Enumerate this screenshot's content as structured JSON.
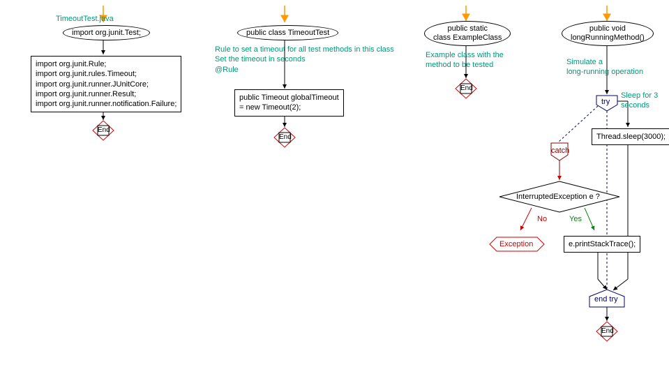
{
  "chart_data": {
    "type": "flowchart",
    "branches": [
      {
        "title": "TimeoutTest.java",
        "nodes": [
          {
            "type": "ellipse",
            "text": "import org.junit.Test;"
          },
          {
            "type": "rect",
            "text": "import org.junit.Rule;\nimport org.junit.rules.Timeout;\nimport org.junit.runner.JUnitCore;\nimport org.junit.runner.Result;\nimport org.junit.runner.notification.Failure;"
          },
          {
            "type": "end",
            "text": "End"
          }
        ]
      },
      {
        "nodes": [
          {
            "type": "ellipse",
            "text": "public class TimeoutTest"
          },
          {
            "type": "comment",
            "text": "Rule to set a timeout for all test methods in this class\nSet the timeout in seconds\n@Rule"
          },
          {
            "type": "rect",
            "text": "public Timeout globalTimeout\n= new Timeout(2);"
          },
          {
            "type": "end",
            "text": "End"
          }
        ]
      },
      {
        "nodes": [
          {
            "type": "ellipse",
            "text": "public static\nclass ExampleClass"
          },
          {
            "type": "comment",
            "text": "Example class with the\nmethod to be tested"
          },
          {
            "type": "end",
            "text": "End"
          }
        ]
      },
      {
        "nodes": [
          {
            "type": "ellipse",
            "text": "public void\nlongRunningMethod()"
          },
          {
            "type": "comment",
            "text": "Simulate a\nlong-running operation"
          },
          {
            "type": "try",
            "text": "try",
            "side_comment": "Sleep for 3 seconds"
          },
          {
            "type": "rect",
            "text": "Thread.sleep(3000);"
          },
          {
            "type": "catch",
            "text": "catch"
          },
          {
            "type": "diamond",
            "text": "InterruptedException e ?",
            "yes": "Yes",
            "no": "No"
          },
          {
            "type": "hexagon",
            "text": "Exception"
          },
          {
            "type": "rect",
            "text": "e.printStackTrace();"
          },
          {
            "type": "endtry",
            "text": "end try"
          },
          {
            "type": "end",
            "text": "End"
          }
        ]
      }
    ]
  },
  "b1": {
    "title": "TimeoutTest.java",
    "n1": "import org.junit.Test;",
    "n2l1": "import org.junit.Rule;",
    "n2l2": "import org.junit.rules.Timeout;",
    "n2l3": "import org.junit.runner.JUnitCore;",
    "n2l4": "import org.junit.runner.Result;",
    "n2l5": "import org.junit.runner.notification.Failure;",
    "end": "End"
  },
  "b2": {
    "n1": "public class TimeoutTest",
    "c1": "Rule to set a timeout for all test methods in this class",
    "c2": "Set the timeout in seconds",
    "c3": "@Rule",
    "n2l1": "public Timeout globalTimeout",
    "n2l2": "= new Timeout(2);",
    "end": "End"
  },
  "b3": {
    "n1l1": "public static",
    "n1l2": "class ExampleClass",
    "c1": "Example class with the",
    "c2": "method to be tested",
    "end": "End"
  },
  "b4": {
    "n1l1": "public void",
    "n1l2": "longRunningMethod()",
    "c1": "Simulate a",
    "c2": "long-running operation",
    "try": "try",
    "tryc": "Sleep for 3 seconds",
    "sleep": "Thread.sleep(3000);",
    "catch": "catch",
    "diamond": "InterruptedException e ?",
    "no": "No",
    "yes": "Yes",
    "exc": "Exception",
    "print": "e.printStackTrace();",
    "endtry": "end try",
    "end": "End"
  }
}
